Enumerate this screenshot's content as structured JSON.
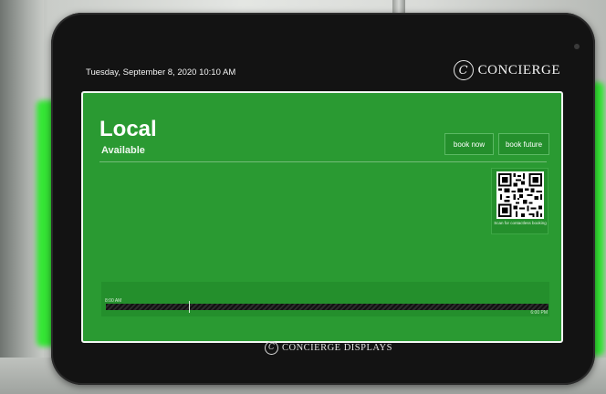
{
  "header": {
    "datetime": "Tuesday, September 8, 2020 10:10 AM",
    "brand_mark": "C",
    "brand_name": "CONCIERGE"
  },
  "room": {
    "name": "Local",
    "status": "Available",
    "status_color": "#2a9a32"
  },
  "actions": {
    "book_now_label": "book now",
    "book_future_label": "book future"
  },
  "qr": {
    "caption": "Scan for contactless booking"
  },
  "timeline": {
    "start_label": "8:00 AM",
    "end_label": "6:00 PM"
  },
  "footer": {
    "brand_mark": "C",
    "brand_name": "CONCIERGE DISPLAYS"
  },
  "icons": {
    "header_logo": "concierge-logo-icon",
    "footer_logo": "concierge-logo-icon",
    "qr": "qr-code-icon"
  }
}
